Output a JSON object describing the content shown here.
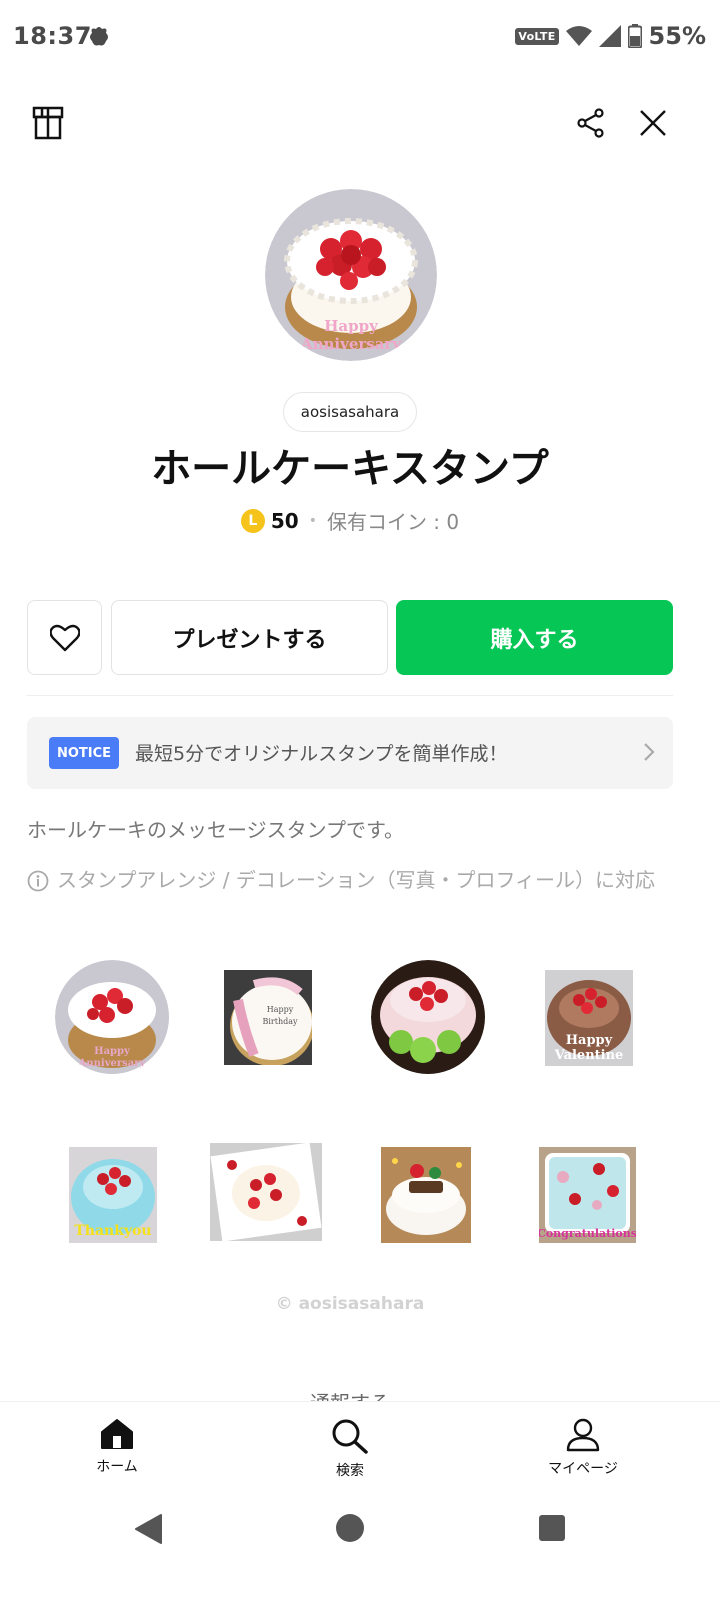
{
  "status_bar": {
    "time": "18:37",
    "volte": "VoLTE",
    "battery": "55%"
  },
  "header": {
    "left_icon": "gift-box-icon",
    "share_icon": "share-icon",
    "close_icon": "close-icon"
  },
  "product": {
    "author": "aosisasahara",
    "title": "ホールケーキスタンプ",
    "coin_symbol": "L",
    "price": "50",
    "separator": "•",
    "owned_coins": "保有コイン : 0",
    "main_image_caption": [
      "Happy",
      "Anniversary"
    ]
  },
  "actions": {
    "favorite_icon": "heart-icon",
    "present_label": "プレゼントする",
    "buy_label": "購入する"
  },
  "notice": {
    "badge": "NOTICE",
    "text": "最短5分でオリジナルスタンプを簡単作成！"
  },
  "description": "ホールケーキのメッセージスタンプです。",
  "info": "スタンプアレンジ / デコレーション（写真・プロフィール）に対応",
  "stickers": [
    {
      "caption": "Happy Anniversary",
      "caption_color": "#e8a6c8"
    },
    {
      "caption": "Happy Birthday",
      "caption_color": "#555555"
    },
    {
      "caption": "",
      "caption_color": ""
    },
    {
      "caption": "Happy Valentine",
      "caption_color": "#ffffff"
    },
    {
      "caption": "Thankyou",
      "caption_color": "#f5e11a"
    },
    {
      "caption": "",
      "caption_color": ""
    },
    {
      "caption": "",
      "caption_color": ""
    },
    {
      "caption": "Congratulations",
      "caption_color": "#d6339a"
    }
  ],
  "copyright": "© aosisasahara",
  "report_label": "通報する",
  "bottom_nav": {
    "home": "ホーム",
    "search": "検索",
    "mypage": "マイページ"
  },
  "colors": {
    "brand_green": "#06c755",
    "notice_blue": "#4a7cf7",
    "coin_yellow": "#f5c31a"
  }
}
